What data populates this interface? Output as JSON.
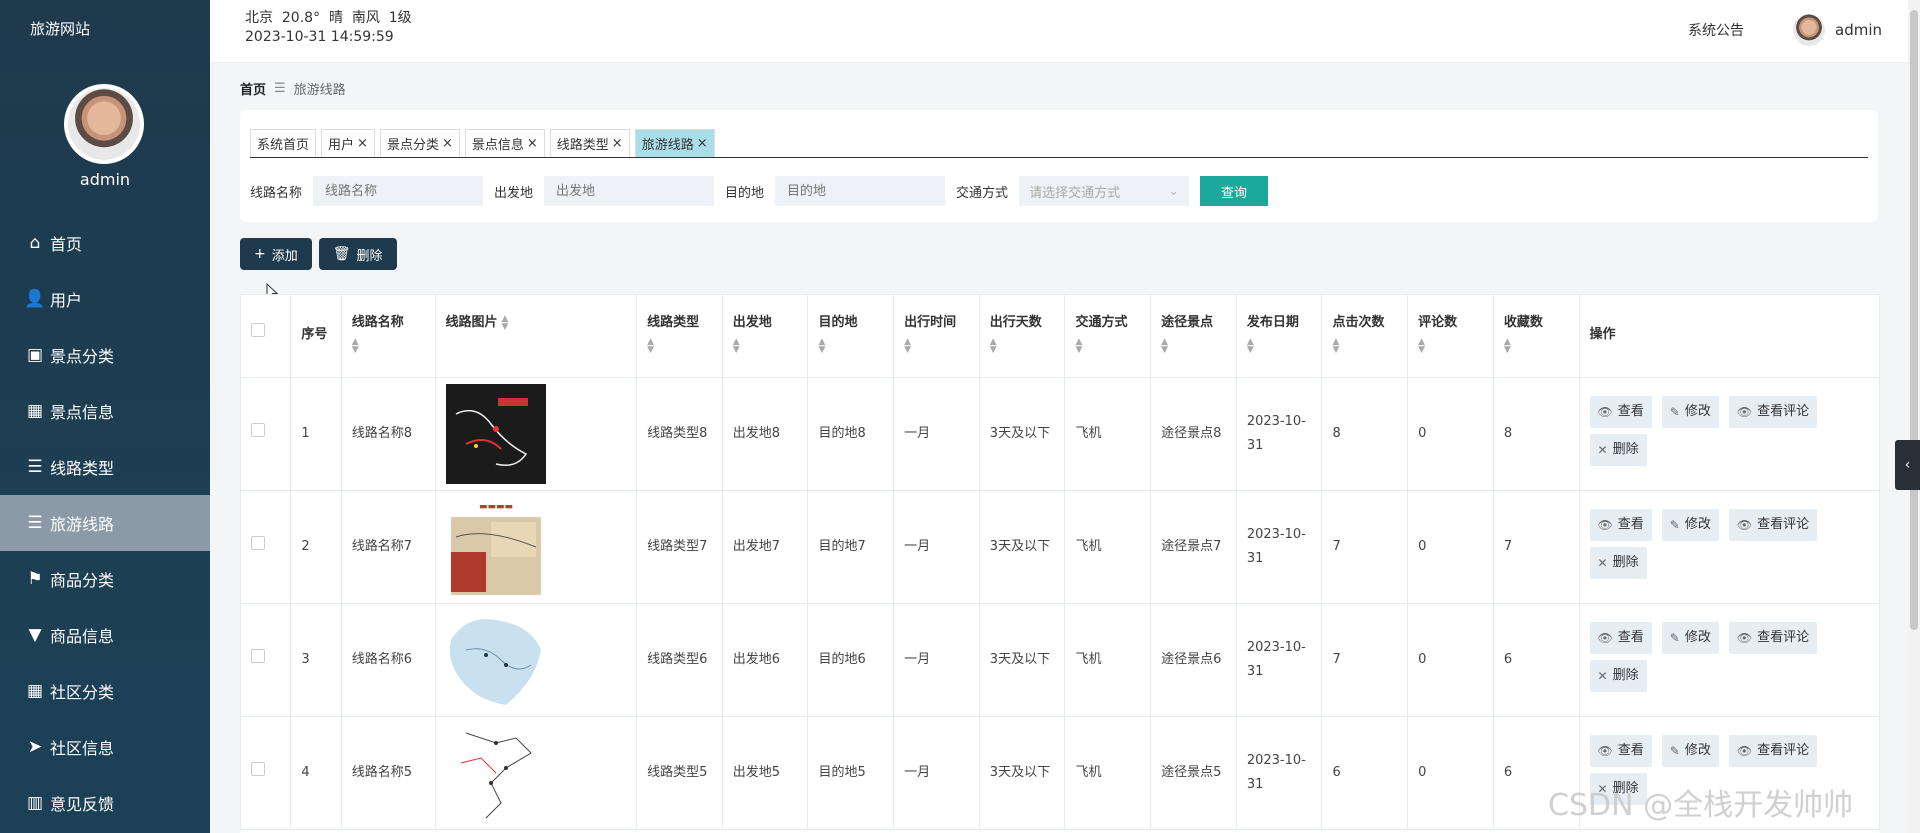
{
  "sidebar": {
    "brand": "旅游网站",
    "username": "admin",
    "items": [
      {
        "label": "首页",
        "icon": "home-icon",
        "glyph": "⌂"
      },
      {
        "label": "用户",
        "icon": "user-icon",
        "glyph": "👤"
      },
      {
        "label": "景点分类",
        "icon": "wallet-icon",
        "glyph": "▣"
      },
      {
        "label": "景点信息",
        "icon": "grid-icon",
        "glyph": "▦"
      },
      {
        "label": "线路类型",
        "icon": "list-icon",
        "glyph": "☰"
      },
      {
        "label": "旅游线路",
        "icon": "list-icon",
        "glyph": "☰",
        "active": true
      },
      {
        "label": "商品分类",
        "icon": "flag-icon",
        "glyph": "⚑"
      },
      {
        "label": "商品信息",
        "icon": "pin-icon",
        "glyph": "▼"
      },
      {
        "label": "社区分类",
        "icon": "grid-icon",
        "glyph": "▦"
      },
      {
        "label": "社区信息",
        "icon": "send-icon",
        "glyph": "➤"
      },
      {
        "label": "意见反馈",
        "icon": "chart-icon",
        "glyph": "▥"
      }
    ]
  },
  "header": {
    "weather": "北京  20.8°  晴  南风  1级",
    "datetime": "2023-10-31 14:59:59",
    "notice": "系统公告",
    "username": "admin"
  },
  "breadcrumb": {
    "home": "首页",
    "current": "旅游线路"
  },
  "tabs": [
    {
      "label": "系统首页",
      "closable": false
    },
    {
      "label": "用户",
      "closable": true
    },
    {
      "label": "景点分类",
      "closable": true
    },
    {
      "label": "景点信息",
      "closable": true
    },
    {
      "label": "线路类型",
      "closable": true
    },
    {
      "label": "旅游线路",
      "closable": true,
      "active": true
    }
  ],
  "filters": {
    "name_label": "线路名称",
    "name_placeholder": "线路名称",
    "from_label": "出发地",
    "from_placeholder": "出发地",
    "to_label": "目的地",
    "to_placeholder": "目的地",
    "transport_label": "交通方式",
    "transport_placeholder": "请选择交通方式",
    "query_button": "查询"
  },
  "actions": {
    "add": "添加",
    "delete": "删除"
  },
  "table": {
    "headers": [
      "序号",
      "线路名称",
      "线路图片",
      "线路类型",
      "出发地",
      "目的地",
      "出行时间",
      "出行天数",
      "交通方式",
      "途径景点",
      "发布日期",
      "点击次数",
      "评论数",
      "收藏数",
      "操作"
    ],
    "op_labels": {
      "view": "查看",
      "edit": "修改",
      "comments": "查看评论",
      "delete": "删除"
    },
    "rows": [
      {
        "index": "1",
        "name": "线路名称8",
        "type": "线路类型8",
        "from": "出发地8",
        "to": "目的地8",
        "month": "一月",
        "days": "3天及以下",
        "transport": "飞机",
        "spots": "途径景点8",
        "date": "2023-10-31",
        "clicks": "8",
        "comments": "0",
        "favorites": "8",
        "image": "map-dark"
      },
      {
        "index": "2",
        "name": "线路名称7",
        "type": "线路类型7",
        "from": "出发地7",
        "to": "目的地7",
        "month": "一月",
        "days": "3天及以下",
        "transport": "飞机",
        "spots": "途径景点7",
        "date": "2023-10-31",
        "clicks": "7",
        "comments": "0",
        "favorites": "7",
        "image": "map-illustrated"
      },
      {
        "index": "3",
        "name": "线路名称6",
        "type": "线路类型6",
        "from": "出发地6",
        "to": "目的地6",
        "month": "一月",
        "days": "3天及以下",
        "transport": "飞机",
        "spots": "途径景点6",
        "date": "2023-10-31",
        "clicks": "7",
        "comments": "0",
        "favorites": "6",
        "image": "map-blue"
      },
      {
        "index": "4",
        "name": "线路名称5",
        "type": "线路类型5",
        "from": "出发地5",
        "to": "目的地5",
        "month": "一月",
        "days": "3天及以下",
        "transport": "飞机",
        "spots": "途径景点5",
        "date": "2023-10-31",
        "clicks": "6",
        "comments": "0",
        "favorites": "6",
        "image": "map-line"
      }
    ]
  },
  "watermark": "CSDN @全栈开发帅帅"
}
